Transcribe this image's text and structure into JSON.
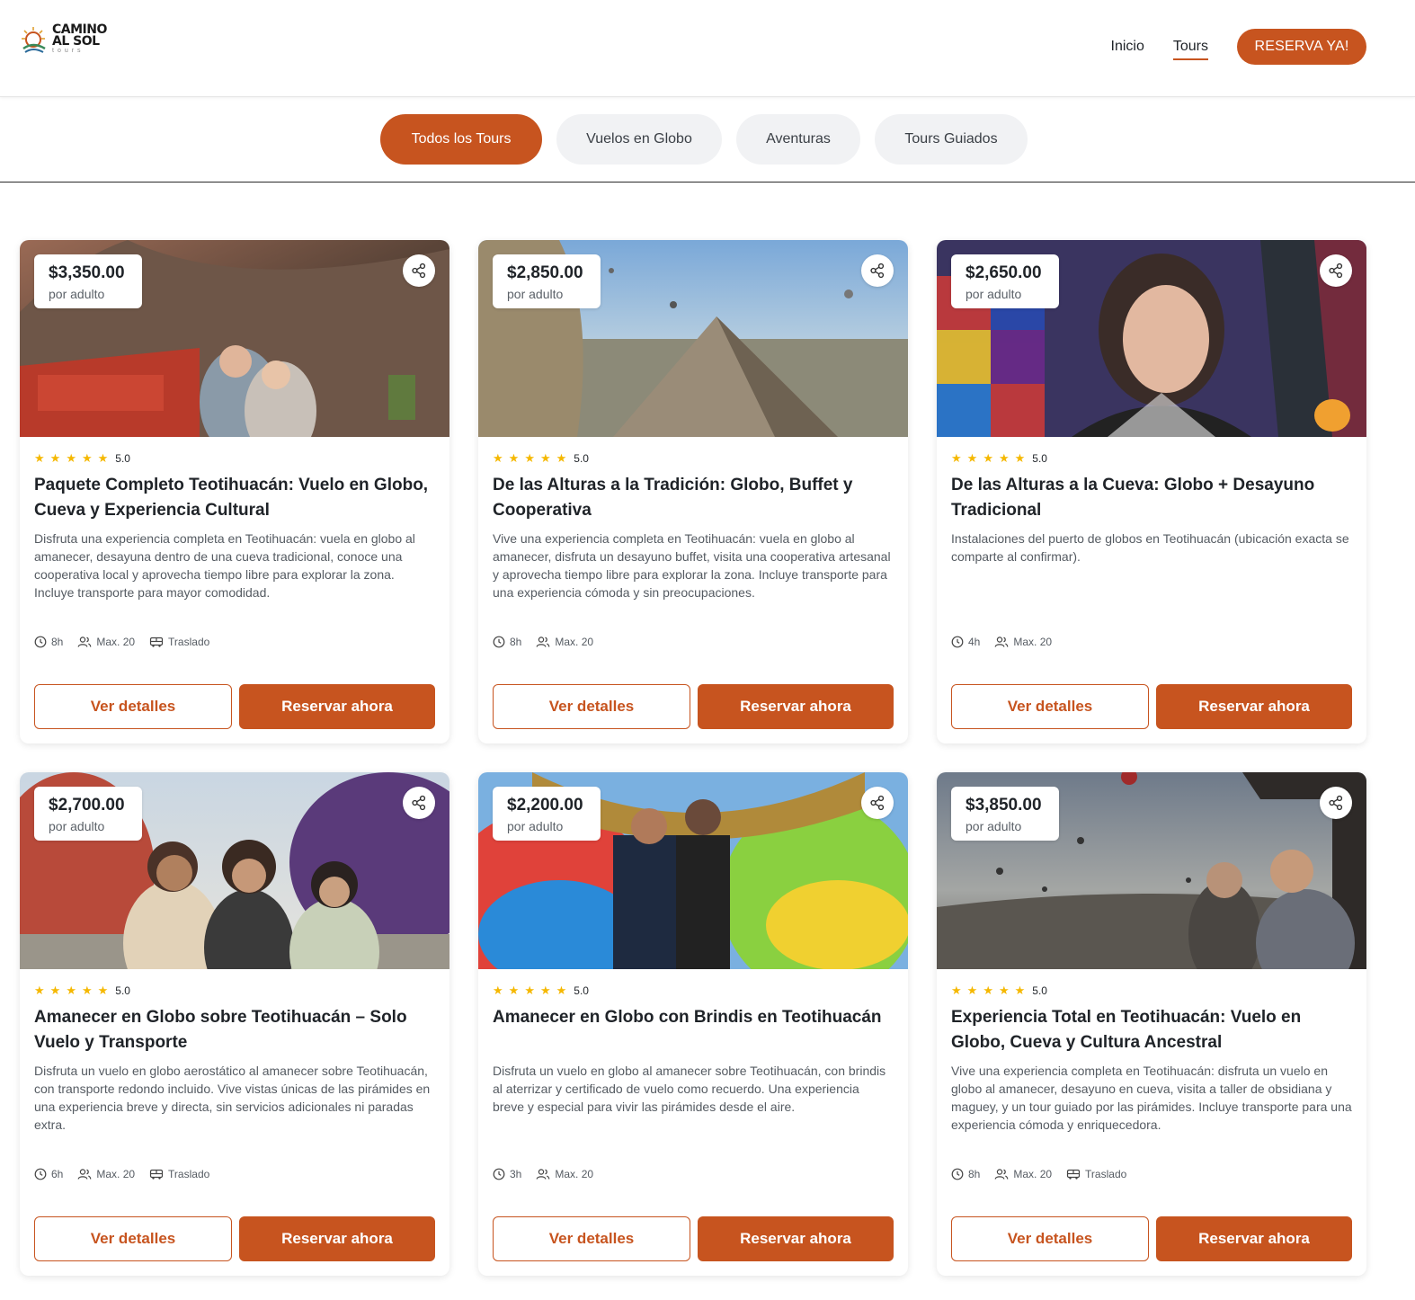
{
  "brand": {
    "logo_line1": "CAMINO",
    "logo_line2": "AL SOL",
    "logo_sub": "tours",
    "accent": "#c7541f"
  },
  "nav": {
    "items": [
      {
        "label": "Inicio"
      },
      {
        "label": "Tours",
        "active": true
      }
    ],
    "cta": "RESERVA YA!"
  },
  "filters": [
    {
      "label": "Todos los Tours",
      "active": true
    },
    {
      "label": "Vuelos en Globo",
      "active": false
    },
    {
      "label": "Aventuras",
      "active": false
    },
    {
      "label": "Tours Guiados",
      "active": false
    }
  ],
  "cards": [
    {
      "price": "$3,350.00",
      "price_unit": "por adulto",
      "rating": "5.0",
      "stars": 5,
      "title": "Paquete Completo Teotihuacán: Vuelo en Globo, Cueva y Experiencia Cultural",
      "description": "Disfruta una experiencia completa en Teotihuacán: vuela en globo al amanecer, desayuna dentro de una cueva tradicional, conoce una cooperativa local y aprovecha tiempo libre para explorar la zona. Incluye transporte para mayor comodidad.",
      "duration": "8h",
      "capacity": "Max. 20",
      "transfer": "Traslado",
      "details_label": "Ver detalles",
      "book_label": "Reservar ahora",
      "photo": "cave"
    },
    {
      "price": "$2,850.00",
      "price_unit": "por adulto",
      "rating": "5.0",
      "stars": 5,
      "title": "De las Alturas a la Tradición: Globo, Buffet y Cooperativa",
      "description": "Vive una experiencia completa en Teotihuacán: vuela en globo al amanecer, disfruta un desayuno buffet, visita una cooperativa artesanal y aprovecha tiempo libre para explorar la zona. Incluye transporte para una experiencia cómoda y sin preocupaciones.",
      "duration": "8h",
      "capacity": "Max. 20",
      "transfer": "",
      "details_label": "Ver detalles",
      "book_label": "Reservar ahora",
      "photo": "pyramid"
    },
    {
      "price": "$2,650.00",
      "price_unit": "por adulto",
      "rating": "5.0",
      "stars": 5,
      "title": "De las Alturas a la Cueva: Globo + Desayuno Tradicional",
      "description": "Instalaciones del puerto de globos en Teotihuacán (ubicación exacta se comparte al confirmar).",
      "duration": "4h",
      "capacity": "Max. 20",
      "transfer": "",
      "details_label": "Ver detalles",
      "book_label": "Reservar ahora",
      "photo": "balloon"
    },
    {
      "price": "$2,700.00",
      "price_unit": "por adulto",
      "rating": "5.0",
      "stars": 5,
      "title": "Amanecer en Globo sobre Teotihuacán – Solo Vuelo y Transporte",
      "description": "Disfruta un vuelo en globo aerostático al amanecer sobre Teotihuacán, con transporte redondo incluido. Vive vistas únicas de las pirámides en una experiencia breve y directa, sin servicios adicionales ni paradas extra.",
      "duration": "6h",
      "capacity": "Max. 20",
      "transfer": "Traslado",
      "details_label": "Ver detalles",
      "book_label": "Reservar ahora",
      "photo": "friends"
    },
    {
      "price": "$2,200.00",
      "price_unit": "por adulto",
      "rating": "5.0",
      "stars": 5,
      "title": "Amanecer en Globo con Brindis en Teotihuacán",
      "description": "Disfruta un vuelo en globo al amanecer sobre Teotihuacán, con brindis al aterrizar y certificado de vuelo como recuerdo. Una experiencia breve y especial para vivir las pirámides desde el aire.",
      "duration": "3h",
      "capacity": "Max. 20",
      "transfer": "",
      "details_label": "Ver detalles",
      "book_label": "Reservar ahora",
      "photo": "couple"
    },
    {
      "price": "$3,850.00",
      "price_unit": "por adulto",
      "rating": "5.0",
      "stars": 5,
      "title": "Experiencia Total en Teotihuacán: Vuelo en Globo, Cueva y Cultura Ancestral",
      "description": "Vive una experiencia completa en Teotihuacán: disfruta un vuelo en globo al amanecer, desayuno en cueva, visita a taller de obsidiana y maguey, y un tour guiado por las pirámides. Incluye transporte para una experiencia cómoda y enriquecedora.",
      "duration": "8h",
      "capacity": "Max. 20",
      "transfer": "Traslado",
      "details_label": "Ver detalles",
      "book_label": "Reservar ahora",
      "photo": "sky"
    }
  ]
}
